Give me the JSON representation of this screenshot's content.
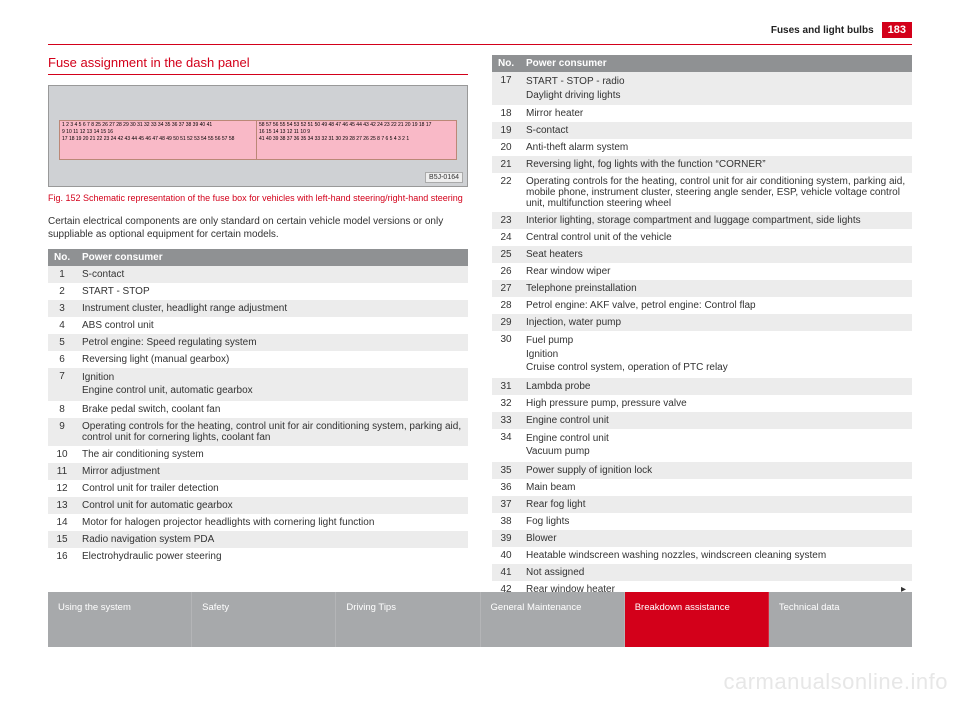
{
  "header": {
    "title": "Fuses and light bulbs",
    "page_number": "183"
  },
  "section_title": "Fuse assignment in the dash panel",
  "figure": {
    "left_block": {
      "rows": [
        "1 2 3 4 5 6 7 8 25 26 27 28 29 30 31 32 33 34 35 36 37 38 39 40 41",
        "9 10 11 12 13 14 15 16",
        "17 18 19 20 21 22 23 24 42 43 44 45 46 47 48 49 50 51 52 53 54 55 56 57 58"
      ]
    },
    "right_block": {
      "rows": [
        "58 57 56 55 54 53 52 51 50 49 48 47 46 45 44 43 42 24 23 22 21 20 19 18 17",
        "16 15 14 13 12 11 10 9",
        "41 40 39 38 37 36 35 34 33 32 31 30 29 28 27 26 25 8 7 6 5 4 3 2 1"
      ]
    },
    "label": "B5J-0164"
  },
  "caption": "Fig. 152  Schematic representation of the fuse box for vehicles with left-hand steering/right-hand steering",
  "intro": "Certain electrical components are only standard on certain vehicle model versions or only suppliable as optional equipment for certain models.",
  "table_header": {
    "no": "No.",
    "consumer": "Power consumer"
  },
  "left_rows": [
    {
      "no": "1",
      "text": "S-contact"
    },
    {
      "no": "2",
      "text": "START - STOP"
    },
    {
      "no": "3",
      "text": "Instrument cluster, headlight range adjustment"
    },
    {
      "no": "4",
      "text": "ABS control unit"
    },
    {
      "no": "5",
      "text": "Petrol engine: Speed regulating system"
    },
    {
      "no": "6",
      "text": "Reversing light (manual gearbox)"
    },
    {
      "no": "7",
      "text": "Ignition\nEngine control unit, automatic gearbox"
    },
    {
      "no": "8",
      "text": "Brake pedal switch, coolant fan"
    },
    {
      "no": "9",
      "text": "Operating controls for the heating, control unit for air conditioning system, parking aid, control unit for cornering lights, coolant fan"
    },
    {
      "no": "10",
      "text": "The air conditioning system"
    },
    {
      "no": "11",
      "text": "Mirror adjustment"
    },
    {
      "no": "12",
      "text": "Control unit for trailer detection"
    },
    {
      "no": "13",
      "text": "Control unit for automatic gearbox"
    },
    {
      "no": "14",
      "text": "Motor for halogen projector headlights with cornering light function"
    },
    {
      "no": "15",
      "text": "Radio navigation system PDA"
    },
    {
      "no": "16",
      "text": "Electrohydraulic power steering"
    }
  ],
  "right_rows": [
    {
      "no": "17",
      "text": "START - STOP - radio\nDaylight driving lights"
    },
    {
      "no": "18",
      "text": "Mirror heater"
    },
    {
      "no": "19",
      "text": "S-contact"
    },
    {
      "no": "20",
      "text": "Anti-theft alarm system"
    },
    {
      "no": "21",
      "text": "Reversing light, fog lights with the function “CORNER”"
    },
    {
      "no": "22",
      "text": "Operating controls for the heating, control unit for air conditioning system, parking aid, mobile phone, instrument cluster, steering angle sender, ESP, vehicle voltage control unit, multifunction steering wheel"
    },
    {
      "no": "23",
      "text": "Interior lighting, storage compartment and luggage compartment, side lights"
    },
    {
      "no": "24",
      "text": "Central control unit of the vehicle"
    },
    {
      "no": "25",
      "text": "Seat heaters"
    },
    {
      "no": "26",
      "text": "Rear window wiper"
    },
    {
      "no": "27",
      "text": "Telephone preinstallation"
    },
    {
      "no": "28",
      "text": "Petrol engine: AKF valve, petrol engine: Control flap"
    },
    {
      "no": "29",
      "text": "Injection, water pump"
    },
    {
      "no": "30",
      "text": "Fuel pump\nIgnition\nCruise control system, operation of PTC relay"
    },
    {
      "no": "31",
      "text": "Lambda probe"
    },
    {
      "no": "32",
      "text": "High pressure pump, pressure valve"
    },
    {
      "no": "33",
      "text": "Engine control unit"
    },
    {
      "no": "34",
      "text": "Engine control unit\nVacuum pump"
    },
    {
      "no": "35",
      "text": "Power supply of ignition lock"
    },
    {
      "no": "36",
      "text": "Main beam"
    },
    {
      "no": "37",
      "text": "Rear fog light"
    },
    {
      "no": "38",
      "text": "Fog lights"
    },
    {
      "no": "39",
      "text": "Blower"
    },
    {
      "no": "40",
      "text": "Heatable windscreen washing nozzles, windscreen cleaning system"
    },
    {
      "no": "41",
      "text": "Not assigned"
    },
    {
      "no": "42",
      "text": "Rear window heater",
      "cont": true
    }
  ],
  "nav": [
    "Using the system",
    "Safety",
    "Driving Tips",
    "General Maintenance",
    "Breakdown assistance",
    "Technical data"
  ],
  "nav_active_index": 4,
  "watermark": "carmanualsonline.info",
  "continue_arrow": "▸"
}
